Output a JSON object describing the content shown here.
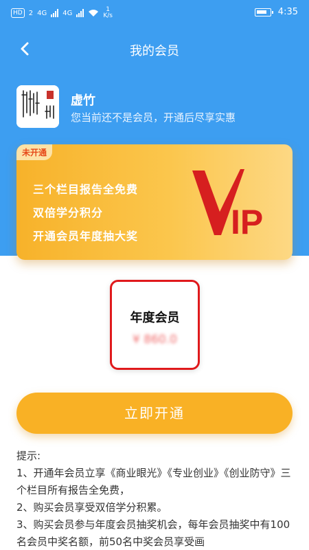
{
  "status_bar": {
    "badge": "HD",
    "sim": "2",
    "net1": "4G",
    "net2": "4G",
    "speed_value": "1",
    "speed_unit": "K/s",
    "time": "4:35"
  },
  "navbar": {
    "title": "我的会员"
  },
  "user": {
    "name": "虚竹",
    "subtitle": "您当前还不是会员，开通后尽享实惠"
  },
  "vip_card": {
    "badge": "未开通",
    "benefits": [
      "三个栏目报告全免费",
      "双倍学分积分",
      "开通会员年度抽大奖"
    ],
    "logo_text": "IP"
  },
  "plan": {
    "name": "年度会员",
    "price": "¥ 860.0"
  },
  "cta": {
    "label": "立即开通"
  },
  "tips": {
    "heading": "提示:",
    "lines": [
      "1、开通年会员立享《商业眼光》《专业创业》《创业防守》三个栏目所有报告全免费，",
      "2、购买会员享受双倍学分积累。",
      "3、购买会员参与年度会员抽奖机会，每年会员抽奖中有100名会员中奖名额，前50名中奖会员享受画"
    ]
  },
  "colors": {
    "header_blue": "#3d9ef1",
    "card_gold": "#f7b22a",
    "cta_orange": "#f9b125",
    "plan_border": "#e0191c",
    "vip_red": "#d61f1f"
  }
}
